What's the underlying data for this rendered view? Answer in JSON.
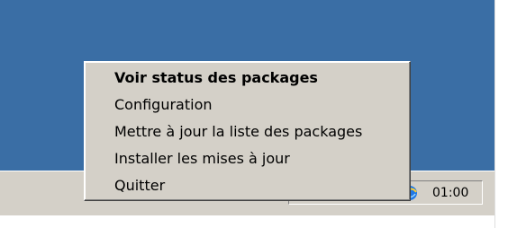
{
  "menu": {
    "items": [
      {
        "label": "Voir status des packages",
        "default": true
      },
      {
        "label": "Configuration",
        "default": false
      },
      {
        "label": "Mettre à jour la liste des packages",
        "default": false
      },
      {
        "label": "Installer les mises à jour",
        "default": false
      },
      {
        "label": "Quitter",
        "default": false
      }
    ]
  },
  "tray": {
    "clock": "01:00",
    "icons": [
      "package-manager-icon",
      "network-icon",
      "tool-icon",
      "browser-globe-icon"
    ]
  },
  "colors": {
    "desktop": "#3a6ea5",
    "taskbar": "#d4d0c8",
    "menu": "#d4d0c8"
  }
}
